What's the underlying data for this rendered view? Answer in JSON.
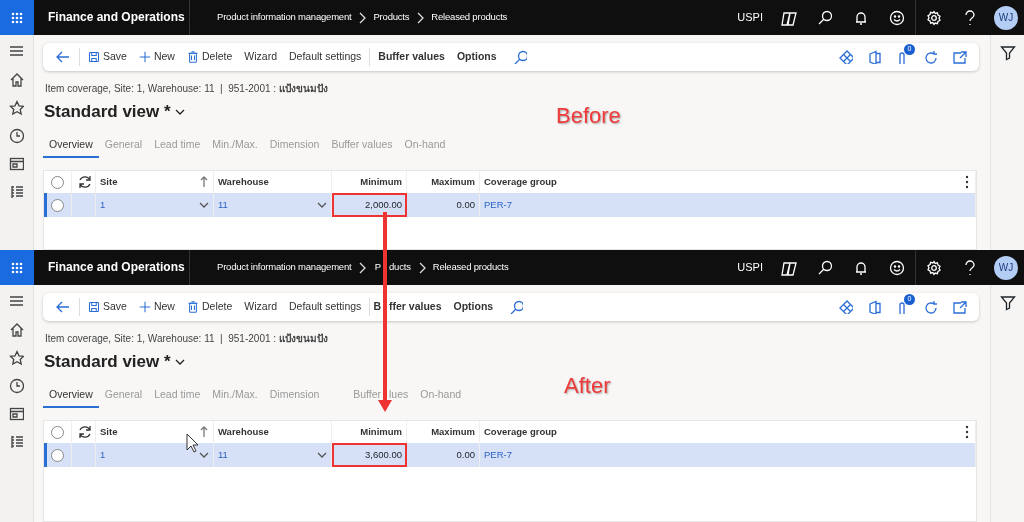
{
  "panels": [
    {
      "app_title": "Finance and Operations",
      "breadcrumb": [
        {
          "parts": [
            "Product information management"
          ]
        },
        {
          "parts": [
            "Products"
          ]
        },
        {
          "parts": [
            "Released products"
          ]
        }
      ],
      "company": "USPI",
      "avatar": "WJ",
      "toolbar": {
        "buttons": [
          {
            "parts": [
              "Save"
            ],
            "kind": "save"
          },
          {
            "parts": [
              "New"
            ],
            "kind": "new"
          },
          {
            "parts": [
              "Delete"
            ],
            "kind": "delete"
          },
          {
            "parts": [
              "Wizard"
            ],
            "kind": "plain"
          },
          {
            "parts": [
              "Default settings"
            ],
            "kind": "plain"
          },
          {
            "parts": [
              "Buffer values"
            ],
            "kind": "menu"
          },
          {
            "parts": [
              "Options"
            ],
            "kind": "menu"
          }
        ],
        "attachments_count": "0"
      },
      "subtitle": "Item coverage, Site: 1, Warehouse: 11  |  951-2001 : **แป้งขนมปัง**",
      "view_title": "Standard view *",
      "tabs": [
        {
          "parts": [
            "Overview"
          ],
          "selected": true
        },
        {
          "parts": [
            "General"
          ],
          "selected": false
        },
        {
          "parts": [
            "Lead time"
          ],
          "selected": false
        },
        {
          "parts": [
            "Min./Max."
          ],
          "selected": false
        },
        {
          "parts": [
            "Dimension"
          ],
          "selected": false
        },
        {
          "parts": [
            "Buffer values"
          ],
          "selected": false
        },
        {
          "parts": [
            "On-hand"
          ],
          "selected": false
        }
      ],
      "grid": {
        "all_selected": false,
        "columns": [
          {
            "label": "Site",
            "sorted": true
          },
          {
            "label": "Warehouse",
            "sorted": false
          },
          {
            "label": "Minimum",
            "sorted": false
          },
          {
            "label": "Maximum",
            "sorted": false
          },
          {
            "label": "Coverage group",
            "sorted": false
          }
        ],
        "rows": [
          {
            "site": "1",
            "warehouse": "11",
            "minimum": "2,000.00",
            "maximum": "0.00",
            "coverage_group": "PER-7",
            "selected": true,
            "checked": false,
            "minimum_highlighted": true
          }
        ]
      },
      "annotation": "Before",
      "cursor_visible": false
    },
    {
      "app_title": "Finance and Operations",
      "breadcrumb": [
        {
          "parts": [
            "Product information management"
          ]
        },
        {
          "parts": [
            "P",
            "ducts"
          ]
        },
        {
          "parts": [
            "Released products"
          ]
        }
      ],
      "company": "USPI",
      "avatar": "WJ",
      "toolbar": {
        "buttons": [
          {
            "parts": [
              "Save"
            ],
            "kind": "save"
          },
          {
            "parts": [
              "New"
            ],
            "kind": "new"
          },
          {
            "parts": [
              "Delete"
            ],
            "kind": "delete"
          },
          {
            "parts": [
              "Wizard"
            ],
            "kind": "plain"
          },
          {
            "parts": [
              "Default settings"
            ],
            "kind": "plain"
          },
          {
            "parts": [
              "B",
              "ffer values"
            ],
            "kind": "menu"
          },
          {
            "parts": [
              "Options"
            ],
            "kind": "menu"
          }
        ],
        "attachments_count": "0"
      },
      "subtitle": "Item coverage, Site: 1, Warehouse: 11  |  951-2001 : **แป้งขนมปัง**",
      "view_title": "Standard view *",
      "tabs": [
        {
          "parts": [
            "Overview"
          ],
          "selected": true
        },
        {
          "parts": [
            "General"
          ],
          "selected": false
        },
        {
          "parts": [
            "Lead time"
          ],
          "selected": false
        },
        {
          "parts": [
            "Min./Max."
          ],
          "selected": false
        },
        {
          "parts": [
            "Dimension"
          ],
          "selected": false
        },
        {
          "parts": [
            "Buffer",
            "lues"
          ],
          "selected": false
        },
        {
          "parts": [
            "On-hand"
          ],
          "selected": false
        }
      ],
      "grid": {
        "all_selected": false,
        "columns": [
          {
            "label": "Site",
            "sorted": true
          },
          {
            "label": "Warehouse",
            "sorted": false
          },
          {
            "label": "Minimum",
            "sorted": false
          },
          {
            "label": "Maximum",
            "sorted": false
          },
          {
            "label": "Coverage group",
            "sorted": false
          }
        ],
        "rows": [
          {
            "site": "1",
            "warehouse": "11",
            "minimum": "3,600.00",
            "maximum": "0.00",
            "coverage_group": "PER-7",
            "selected": true,
            "checked": false,
            "minimum_highlighted": true
          }
        ]
      },
      "annotation": "After",
      "cursor_visible": true
    }
  ]
}
